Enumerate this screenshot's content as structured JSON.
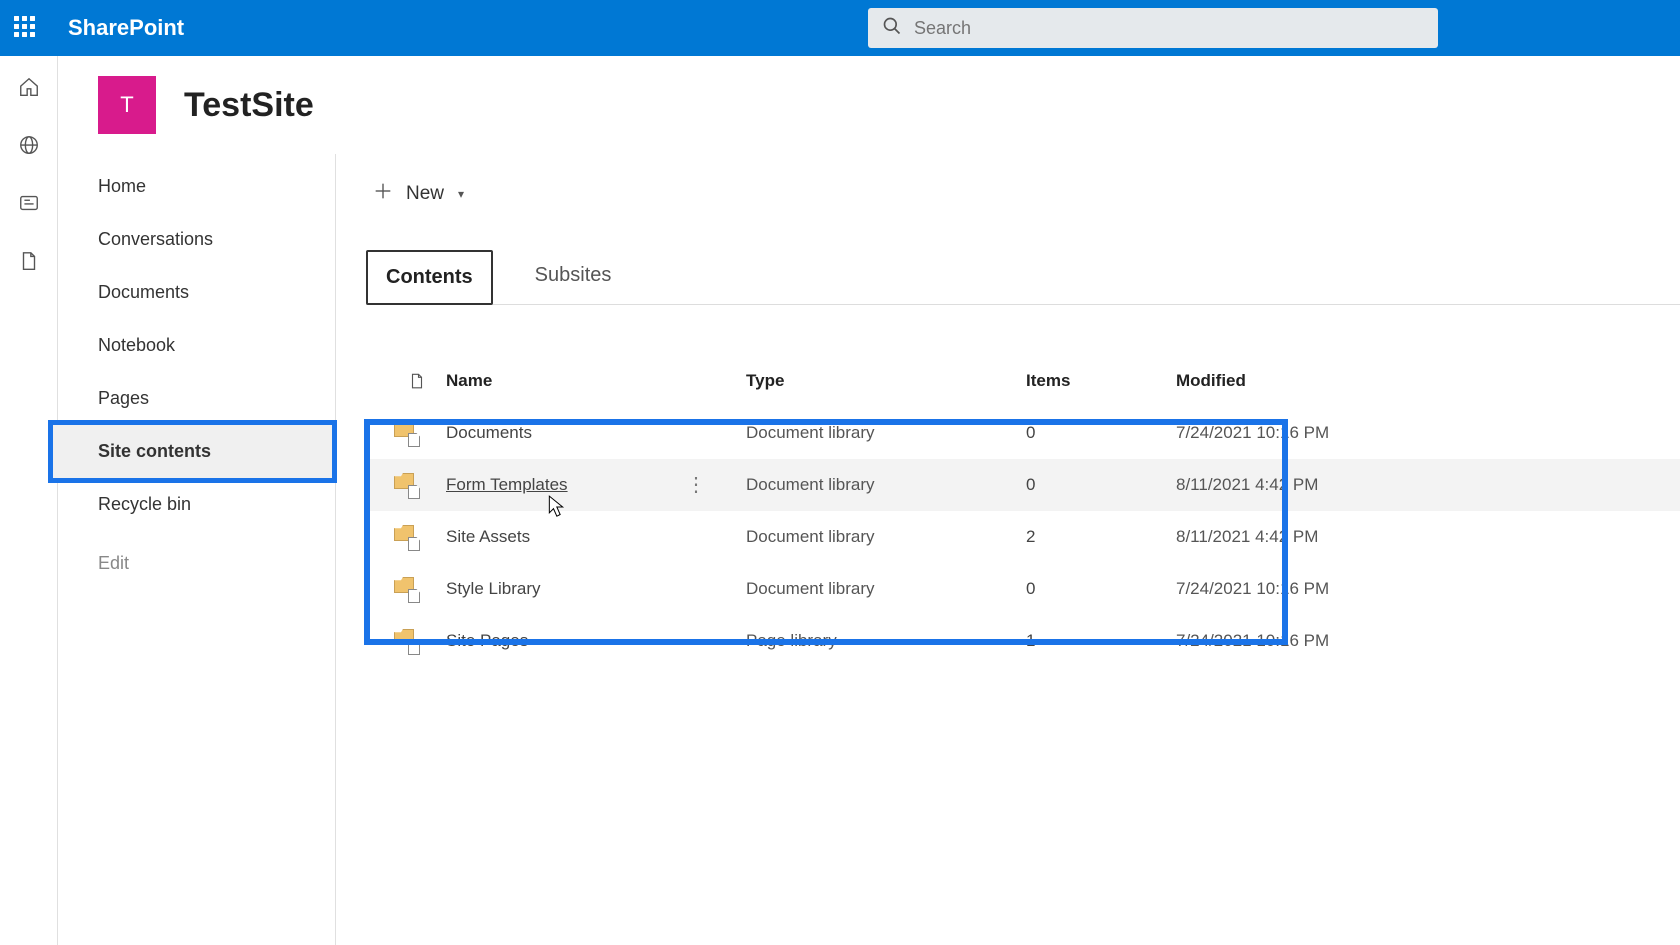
{
  "brand": "SharePoint",
  "search": {
    "placeholder": "Search"
  },
  "site": {
    "logo_letter": "T",
    "title": "TestSite"
  },
  "nav": {
    "items": [
      {
        "label": "Home"
      },
      {
        "label": "Conversations"
      },
      {
        "label": "Documents"
      },
      {
        "label": "Notebook"
      },
      {
        "label": "Pages"
      },
      {
        "label": "Site contents"
      },
      {
        "label": "Recycle bin"
      }
    ],
    "edit_label": "Edit"
  },
  "cmd": {
    "new_label": "New"
  },
  "tabs": {
    "contents": "Contents",
    "subsites": "Subsites"
  },
  "table": {
    "headers": {
      "name": "Name",
      "type": "Type",
      "items": "Items",
      "modified": "Modified"
    },
    "rows": [
      {
        "name": "Documents",
        "type": "Document library",
        "items": "0",
        "modified": "7/24/2021 10:16 PM"
      },
      {
        "name": "Form Templates",
        "type": "Document library",
        "items": "0",
        "modified": "8/11/2021 4:42 PM"
      },
      {
        "name": "Site Assets",
        "type": "Document library",
        "items": "2",
        "modified": "8/11/2021 4:42 PM"
      },
      {
        "name": "Style Library",
        "type": "Document library",
        "items": "0",
        "modified": "7/24/2021 10:16 PM"
      },
      {
        "name": "Site Pages",
        "type": "Page library",
        "items": "1",
        "modified": "7/24/2021 10:16 PM"
      }
    ]
  }
}
